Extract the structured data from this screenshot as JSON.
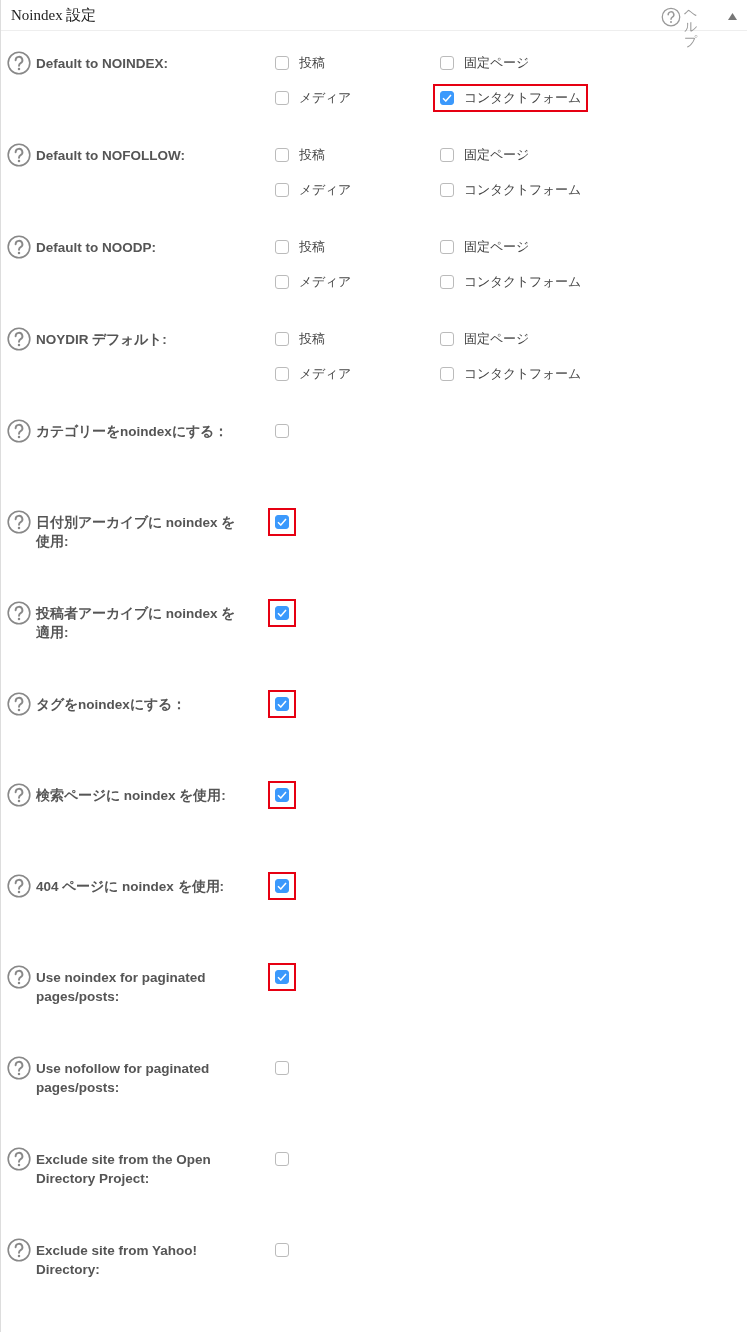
{
  "panel": {
    "title": "Noindex 設定",
    "help_label": "ヘルプ"
  },
  "settings": [
    {
      "kind": "group",
      "label": "Default to NOINDEX:",
      "options": [
        {
          "label": "投稿",
          "checked": false,
          "highlighted": false
        },
        {
          "label": "固定ページ",
          "checked": false,
          "highlighted": false
        },
        {
          "label": "メディア",
          "checked": false,
          "highlighted": false
        },
        {
          "label": "コンタクトフォーム",
          "checked": true,
          "highlighted": true
        }
      ]
    },
    {
      "kind": "group",
      "label": "Default to NOFOLLOW:",
      "options": [
        {
          "label": "投稿",
          "checked": false,
          "highlighted": false
        },
        {
          "label": "固定ページ",
          "checked": false,
          "highlighted": false
        },
        {
          "label": "メディア",
          "checked": false,
          "highlighted": false
        },
        {
          "label": "コンタクトフォーム",
          "checked": false,
          "highlighted": false
        }
      ]
    },
    {
      "kind": "group",
      "label": "Default to NOODP:",
      "options": [
        {
          "label": "投稿",
          "checked": false,
          "highlighted": false
        },
        {
          "label": "固定ページ",
          "checked": false,
          "highlighted": false
        },
        {
          "label": "メディア",
          "checked": false,
          "highlighted": false
        },
        {
          "label": "コンタクトフォーム",
          "checked": false,
          "highlighted": false
        }
      ]
    },
    {
      "kind": "group",
      "label": "NOYDIR デフォルト:",
      "options": [
        {
          "label": "投稿",
          "checked": false,
          "highlighted": false
        },
        {
          "label": "固定ページ",
          "checked": false,
          "highlighted": false
        },
        {
          "label": "メディア",
          "checked": false,
          "highlighted": false
        },
        {
          "label": "コンタクトフォーム",
          "checked": false,
          "highlighted": false
        }
      ]
    },
    {
      "kind": "single",
      "label": "カテゴリーをnoindexにする：",
      "checked": false,
      "highlighted": false
    },
    {
      "kind": "single",
      "label": "日付別アーカイブに noindex を使用:",
      "checked": true,
      "highlighted": true
    },
    {
      "kind": "single",
      "label": "投稿者アーカイブに noindex を適用:",
      "checked": true,
      "highlighted": true
    },
    {
      "kind": "single",
      "label": "タグをnoindexにする：",
      "checked": true,
      "highlighted": true
    },
    {
      "kind": "single",
      "label": "検索ページに noindex を使用:",
      "checked": true,
      "highlighted": true
    },
    {
      "kind": "single",
      "label": "404 ページに noindex を使用:",
      "checked": true,
      "highlighted": true
    },
    {
      "kind": "single",
      "label": "Use noindex for paginated pages/posts:",
      "checked": true,
      "highlighted": true
    },
    {
      "kind": "single",
      "label": "Use nofollow for paginated pages/posts:",
      "checked": false,
      "highlighted": false
    },
    {
      "kind": "single",
      "label": "Exclude site from the Open Directory Project:",
      "checked": false,
      "highlighted": false
    },
    {
      "kind": "single",
      "label": "Exclude site from Yahoo! Directory:",
      "checked": false,
      "highlighted": false
    }
  ]
}
